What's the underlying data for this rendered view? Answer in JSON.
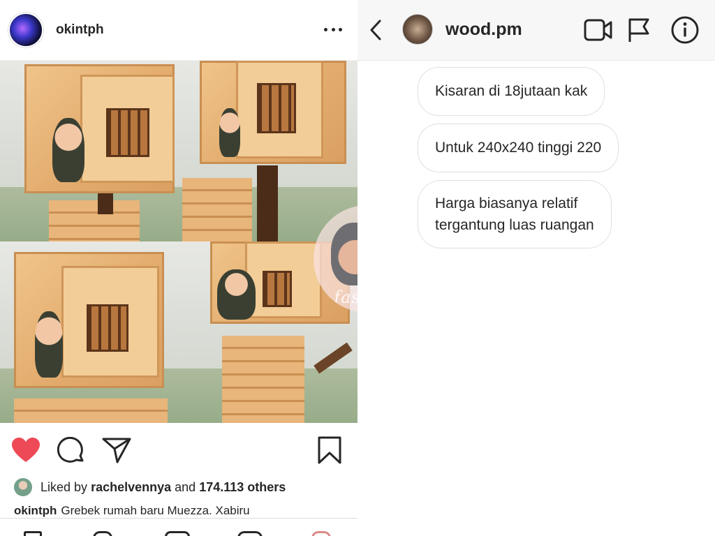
{
  "post": {
    "username": "okintph",
    "image_watermark": "fashion",
    "liked_by_prefix": "Liked by",
    "liked_by_user": "rachelvennya",
    "liked_by_and": "and",
    "liked_by_count": "174.113 others",
    "caption_user": "okintph",
    "caption_text": "Grebek rumah baru Muezza. Xabiru",
    "liked": true,
    "icons": [
      "more-icon",
      "heart-icon",
      "comment-icon",
      "share-icon",
      "bookmark-icon"
    ]
  },
  "dm": {
    "title": "wood.pm",
    "header_icons": [
      "back-icon",
      "video-call-icon",
      "flag-icon",
      "info-icon"
    ],
    "messages": [
      {
        "text": "Kisaran di 18jutaan kak"
      },
      {
        "text": "Untuk 240x240 tinggi 220"
      },
      {
        "text": "Harga biasanya relatif",
        "text2": "tergantung luas ruangan"
      }
    ]
  },
  "colors": {
    "heart": "#ed4956",
    "text": "#262626",
    "border": "#dfdfdf"
  }
}
